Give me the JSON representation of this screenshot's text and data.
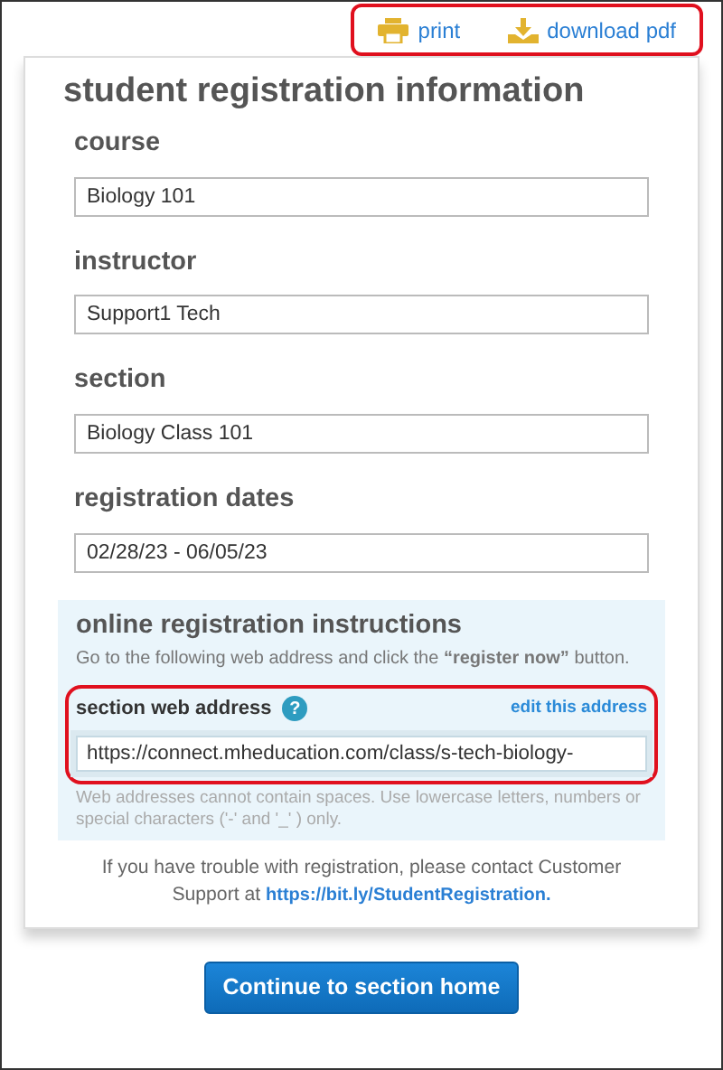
{
  "toolbar": {
    "highlighted": true,
    "actions": [
      {
        "kind": "print",
        "label": "print"
      },
      {
        "kind": "download",
        "label": "download pdf"
      }
    ]
  },
  "title": "student registration information",
  "fields": [
    {
      "label": "course",
      "value": "Biology 101"
    },
    {
      "label": "instructor",
      "value": "Support1 Tech"
    },
    {
      "label": "section",
      "value": "Biology Class 101"
    },
    {
      "label": "registration dates",
      "value": "02/28/23 - 06/05/23"
    }
  ],
  "instructions": {
    "heading": "online registration instructions",
    "text": "Go to the following web address and click the **“register now”** button.",
    "address": {
      "label": "section web address",
      "help_icon": "?",
      "edit_link": "edit this address",
      "value": "https://connect.mheducation.com/class/s-tech-biology-",
      "highlighted": true,
      "hint": "Web addresses cannot contain spaces. Use lowercase letters, numbers or special characters ('-' and '_' ) only."
    }
  },
  "support": {
    "text": "If you have trouble with registration, please contact Customer Support at",
    "link": "https://bit.ly/StudentRegistration."
  },
  "button": "Continue to section home"
}
